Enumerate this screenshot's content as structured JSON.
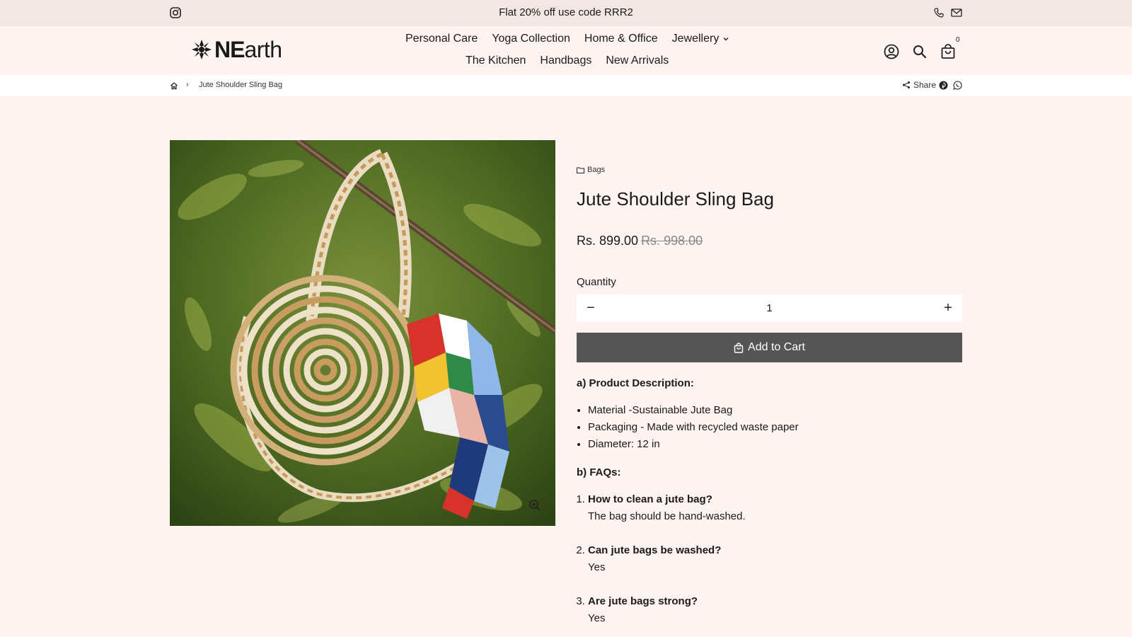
{
  "announcement": {
    "text": "Flat 20% off use code RRR2"
  },
  "logo": {
    "bold": "NE",
    "rest": "arth"
  },
  "nav": {
    "row1": [
      {
        "label": "Personal Care"
      },
      {
        "label": "Yoga Collection"
      },
      {
        "label": "Home & Office"
      },
      {
        "label": "Jewellery"
      }
    ],
    "row2": [
      {
        "label": "The Kitchen"
      },
      {
        "label": "Handbags"
      },
      {
        "label": "New Arrivals"
      }
    ]
  },
  "cart": {
    "count": "0"
  },
  "breadcrumb": {
    "separator": "›",
    "current": "Jute Shoulder Sling Bag"
  },
  "share": {
    "label": "Share"
  },
  "product": {
    "category": "Bags",
    "title": "Jute Shoulder Sling Bag",
    "price": "Rs. 899.00",
    "compare_price": "Rs. 998.00",
    "quantity_label": "Quantity",
    "quantity": "1",
    "minus": "−",
    "plus": "+",
    "add_to_cart": "Add to Cart"
  },
  "description": {
    "heading_a": "a) Product Description:",
    "bullets": [
      "Material -Sustainable Jute Bag",
      "Packaging - Made with recycled waste paper",
      "Diameter: 12 in"
    ],
    "heading_b": "b) FAQs:",
    "faqs": [
      {
        "q": "How to clean a jute bag?",
        "a": "The bag should be hand-washed."
      },
      {
        "q": "Can jute bags be washed?",
        "a": "Yes"
      },
      {
        "q": "Are jute bags strong?",
        "a": "Yes"
      }
    ]
  },
  "icons": {
    "instagram": "instagram-icon",
    "phone": "phone-icon",
    "mail": "mail-icon",
    "account": "account-icon",
    "search": "search-icon",
    "cart": "shopping-bag-icon",
    "home": "home-icon",
    "share": "share-icon",
    "pinterest": "pinterest-icon",
    "whatsapp": "whatsapp-icon",
    "zoom": "zoom-in-icon",
    "folder": "folder-icon"
  }
}
